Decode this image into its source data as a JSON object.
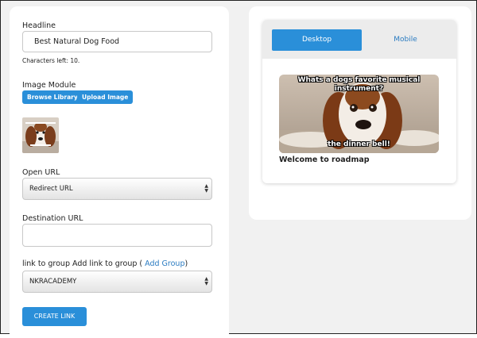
{
  "form": {
    "headline_label": "Headline",
    "headline_value": "Best Natural Dog Food",
    "chars_left": "Characters left: 10.",
    "image_module_label": "Image Module",
    "browse_library": "Browse Library",
    "upload_image": "Upload Image",
    "open_url_label": "Open URL",
    "open_url_value": "Redirect URL",
    "destination_url_label": "Destination URL",
    "destination_url_value": "",
    "group_label_prefix": "link to group Add link to group (",
    "add_group": "Add Group",
    "group_label_suffix": ")",
    "group_value": "NKRACADEMY",
    "create_link": "CREATE LINK"
  },
  "preview": {
    "tab_desktop": "Desktop",
    "tab_mobile": "Mobile",
    "meme_top": "Whats a dogs favorite musical instrument?",
    "meme_bottom": "the dinner bell!",
    "title": "Welcome to roadmap"
  },
  "colors": {
    "accent": "#2a8fd9",
    "link": "#2a7bc1",
    "background": "#f1f1f1"
  }
}
